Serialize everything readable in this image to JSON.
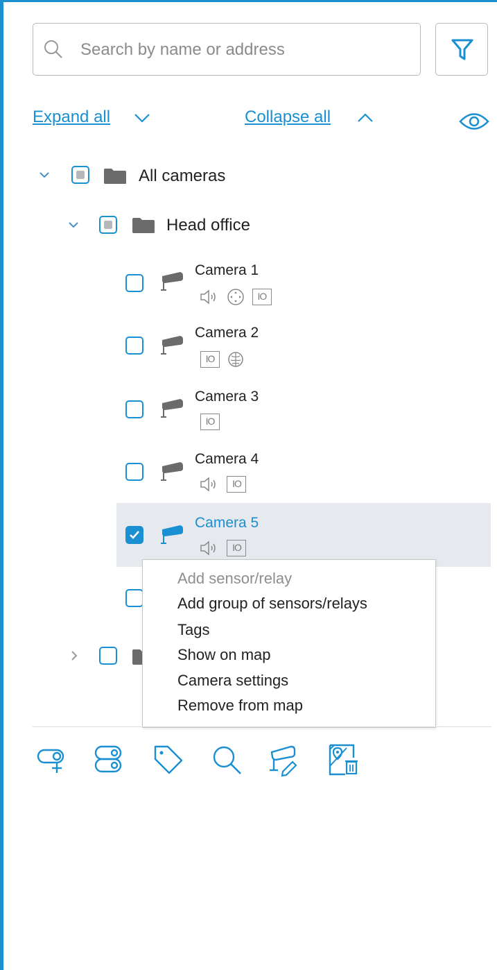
{
  "search": {
    "placeholder": "Search by name or address",
    "value": ""
  },
  "toolbar": {
    "filter_icon": "filter-icon",
    "expand_all": "Expand all",
    "collapse_all": "Collapse all",
    "visibility_icon": "eye-icon"
  },
  "tree": {
    "root": {
      "label": "All cameras",
      "expanded": true,
      "state": "indeterminate"
    },
    "group": {
      "label": "Head office",
      "expanded": true,
      "state": "indeterminate"
    },
    "cameras": [
      {
        "label": "Camera 1",
        "checked": false,
        "icons": [
          "audio-icon",
          "ptz-icon",
          "io-icon"
        ]
      },
      {
        "label": "Camera 2",
        "checked": false,
        "icons": [
          "io-icon",
          "brain-icon"
        ]
      },
      {
        "label": "Camera 3",
        "checked": false,
        "icons": [
          "io-icon"
        ]
      },
      {
        "label": "Camera 4",
        "checked": false,
        "icons": [
          "audio-icon",
          "io-icon"
        ]
      },
      {
        "label": "Camera 5",
        "checked": true,
        "selected": true,
        "icons": [
          "audio-icon",
          "io-icon"
        ]
      }
    ],
    "io_badge": "IO"
  },
  "context_menu": {
    "items": [
      {
        "label": "Add sensor/relay",
        "enabled": false
      },
      {
        "label": "Add group of sensors/relays",
        "enabled": true
      },
      {
        "label": "Tags",
        "enabled": true
      },
      {
        "label": "Show on map",
        "enabled": true
      },
      {
        "label": "Camera settings",
        "enabled": true
      },
      {
        "label": "Remove from map",
        "enabled": true
      }
    ]
  },
  "bottom_toolbar": [
    "add-camera-icon",
    "add-sensor-icon",
    "tag-icon",
    "search-icon",
    "camera-edit-icon",
    "remove-from-map-icon"
  ],
  "colors": {
    "accent": "#1a8fd1",
    "selection": "#e6e9ed",
    "icon_gray": "#6b6b6b"
  }
}
